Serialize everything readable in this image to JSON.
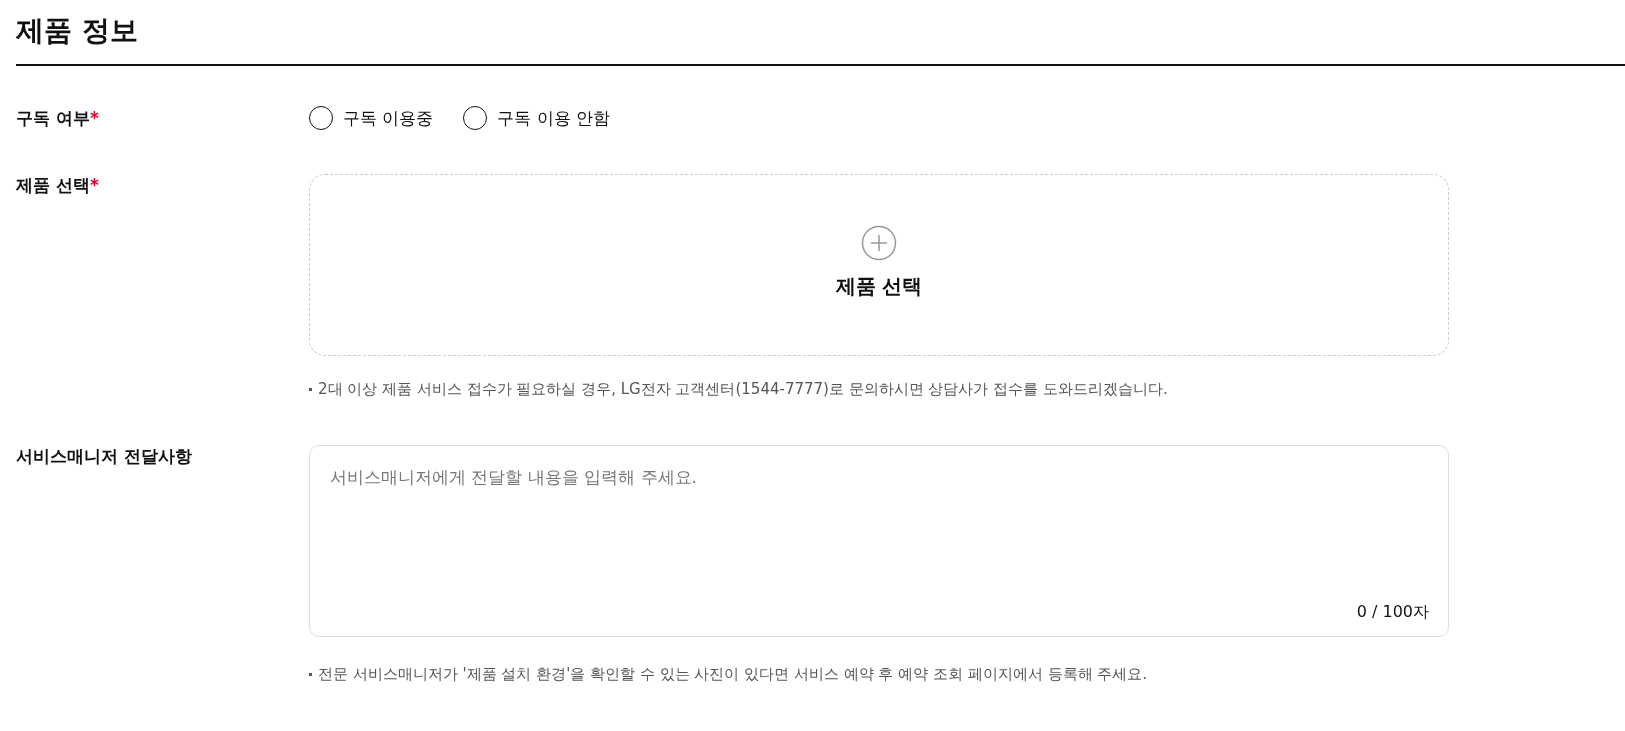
{
  "title": "제품 정보",
  "subscription": {
    "label": "구독 여부",
    "required_mark": "*",
    "options": [
      {
        "label": "구독 이용중",
        "selected": false
      },
      {
        "label": "구독 이용 안함",
        "selected": false
      }
    ]
  },
  "product": {
    "label": "제품 선택",
    "required_mark": "*",
    "button": "제품 선택",
    "note": "2대 이상 제품 서비스 접수가 필요하실 경우, LG전자 고객센터(1544-7777)로 문의하시면 상담사가 접수를 도와드리겠습니다."
  },
  "message": {
    "label": "서비스매니저 전달사항",
    "placeholder": "서비스매니저에게 전달할 내용을 입력해 주세요.",
    "counter": "0 / 100자",
    "note": "전문 서비스매니저가 '제품 설치 환경'을 확인할 수 있는 사진이 있다면 서비스 예약 후 예약 조회 페이지에서 등록해 주세요."
  }
}
